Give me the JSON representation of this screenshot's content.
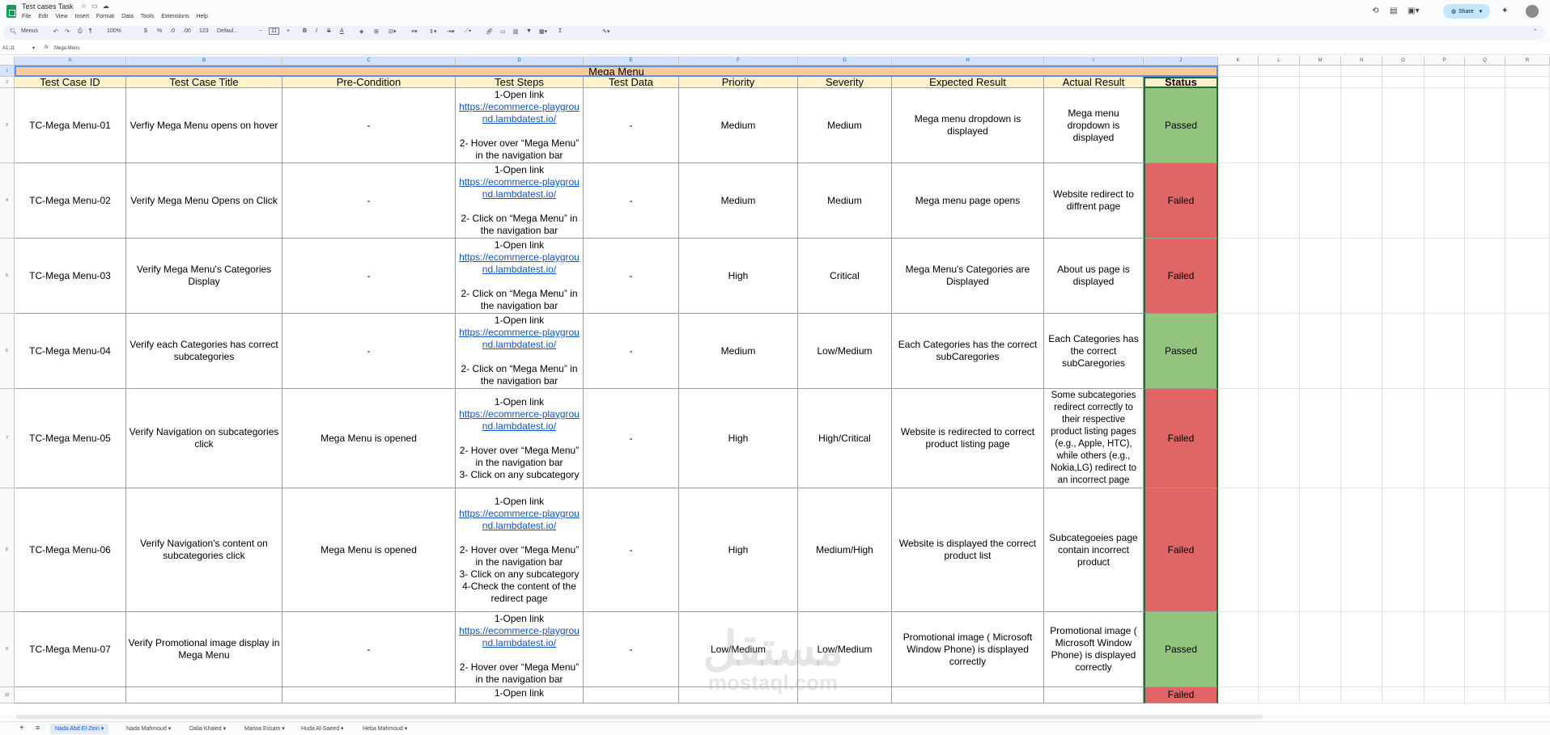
{
  "app": {
    "doc_title": "Test cases Task",
    "menus": [
      "File",
      "Edit",
      "View",
      "Insert",
      "Format",
      "Data",
      "Tools",
      "Extensions",
      "Help"
    ],
    "share_label": "Share"
  },
  "toolbar": {
    "search_label": "Menus",
    "zoom": "100%",
    "currency": "$",
    "percent": "%",
    "dec_dec": ".0",
    "dec_inc": ".00",
    "num_format": "123",
    "font": "Defaul...",
    "font_size": "11",
    "bold": "B",
    "italic": "I",
    "strike": "S",
    "text_color": "A",
    "sum": "Σ"
  },
  "formula_bar": {
    "cell_ref": "A1:J1",
    "content": "Mega Menu"
  },
  "columns": [
    "A",
    "B",
    "C",
    "D",
    "E",
    "F",
    "G",
    "H",
    "I",
    "J",
    "K",
    "L",
    "M",
    "N",
    "O",
    "P",
    "Q",
    "R"
  ],
  "row_numbers": [
    "1",
    "2",
    "3",
    "4",
    "5",
    "6",
    "7",
    "8",
    "9",
    "10"
  ],
  "sheet_title": "Mega Menu",
  "headers": [
    "Test Case ID",
    "Test Case Title",
    "Pre-Condition",
    "Test Steps",
    "Test Data",
    "Priority",
    "Severity",
    "Expected Result",
    "Actual Result",
    "Status"
  ],
  "rows": [
    {
      "id": "TC-Mega Menu-01",
      "title": "Verfiy Mega Menu opens on hover",
      "pre": "-",
      "steps_pre": "1-Open link",
      "link": "https://ecommerce-playground.lambdatest.io/",
      "steps_post": "2- Hover over “Mega Menu” in the navigation bar",
      "data": "-",
      "priority": "Medium",
      "severity": "Medium",
      "expected": "Mega menu dropdown is displayed",
      "actual": "Mega menu dropdown is displayed",
      "status": "Passed"
    },
    {
      "id": "TC-Mega Menu-02",
      "title": "Verify Mega Menu Opens on Click",
      "pre": "-",
      "steps_pre": "1-Open link",
      "link": "https://ecommerce-playground.lambdatest.io/",
      "steps_post": "2- Click on  “Mega Menu” in the navigation bar",
      "data": "-",
      "priority": "Medium",
      "severity": "Medium",
      "expected": "Mega menu page opens",
      "actual": "Website redirect to diffrent page",
      "status": "Failed"
    },
    {
      "id": "TC-Mega Menu-03",
      "title": "Verify Mega Menu's Categories Display",
      "pre": "-",
      "steps_pre": "1-Open link",
      "link": "https://ecommerce-playground.lambdatest.io/",
      "steps_post": "2- Click on  “Mega Menu” in the navigation bar",
      "data": "-",
      "priority": "High",
      "severity": "Critical",
      "expected": "Mega Menu's Categories are Displayed",
      "actual": "About us page is displayed",
      "status": "Failed"
    },
    {
      "id": "TC-Mega Menu-04",
      "title": "Verify each Categories has correct subcategories",
      "pre": "-",
      "steps_pre": "1-Open link",
      "link": "https://ecommerce-playground.lambdatest.io/",
      "steps_post": "2- Click on  “Mega Menu” in the navigation bar",
      "data": "-",
      "priority": "Medium",
      "severity": "Low/Medium",
      "expected": "Each Categories has the correct subCaregories",
      "actual": "Each Categories has the correct subCaregories",
      "status": "Passed"
    },
    {
      "id": "TC-Mega Menu-05",
      "title": "Verify Navigation on subcategories click",
      "pre": "Mega Menu is opened",
      "steps_pre": "1-Open link",
      "link": "https://ecommerce-playground.lambdatest.io/",
      "steps_post": "2- Hover over  “Mega Menu” in the navigation bar\n3- Click on any subcategory",
      "data": "-",
      "priority": "High",
      "severity": "High/Critical",
      "expected": "Website is redirected to correct product listing page",
      "actual": "Some subcategories redirect correctly to their respective product listing pages (e.g., Apple, HTC), while others (e.g., Nokia,LG) redirect to an incorrect page",
      "status": "Failed"
    },
    {
      "id": "TC-Mega Menu-06",
      "title": "Verify Navigation's content on subcategories click",
      "pre": "Mega Menu is opened",
      "steps_pre": "1-Open link",
      "link": "https://ecommerce-playground.lambdatest.io/",
      "steps_post": "2- Hover over  “Mega Menu” in the navigation bar\n3- Click on any subcategory\n4-Check the content of the redirect page",
      "data": "-",
      "priority": "High",
      "severity": "Medium/High",
      "expected": "Website is displayed the correct product list",
      "actual": "Subcategoeies page contain incorrect product",
      "status": "Failed"
    },
    {
      "id": "TC-Mega Menu-07",
      "title": "Verify Promotional image display in Mega Menu",
      "pre": "-",
      "steps_pre": "1-Open link",
      "link": "https://ecommerce-playground.lambdatest.io/",
      "steps_post": "2- Hover over  “Mega Menu” in the navigation bar",
      "data": "-",
      "priority": "Low/Medium",
      "severity": "Low/Medium",
      "expected": "Promotional image ( Microsoft Window Phone) is displayed correctly",
      "actual": "Promotional image ( Microsoft Window Phone) is displayed correctly",
      "status": "Passed"
    },
    {
      "id": "",
      "title": "",
      "pre": "",
      "steps_pre": "1-Open link",
      "link": "",
      "steps_post": "",
      "data": "",
      "priority": "",
      "severity": "",
      "expected": "",
      "actual": "",
      "status": "Failed"
    }
  ],
  "sheet_tabs": [
    "Nada Abd El-Zein",
    "Nada Mahmoud",
    "Dalia Khaled",
    "Marwa Essam",
    "Huda Al-Saeed",
    "Heba Mahmoud"
  ],
  "active_tab": 0,
  "watermark": {
    "line1": "مستقل",
    "line2": "mostaql.com"
  },
  "colors": {
    "header_fill": "#fff2cc",
    "title_fill": "#f9cb9c",
    "passed": "#93c47d",
    "failed": "#e06666",
    "link": "#1155cc"
  }
}
